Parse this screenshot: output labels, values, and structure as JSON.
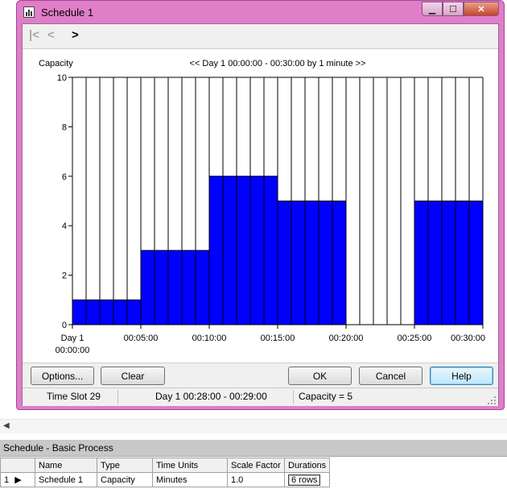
{
  "window": {
    "title": "Schedule 1"
  },
  "titlebar": {
    "minimize": "▁",
    "maximize": "☐",
    "close": "✕"
  },
  "nav": {
    "first": "|<",
    "prev": "<",
    "next": ">"
  },
  "chart_data": {
    "type": "bar",
    "ylabel": "Capacity",
    "title": "<< Day 1  00:00:00 - 00:30:00  by 1 minute >>",
    "ylim": [
      0,
      10
    ],
    "yticks": [
      0,
      2,
      4,
      6,
      8,
      10
    ],
    "xlim": [
      0,
      30
    ],
    "xticks": [
      {
        "pos": 0,
        "label": "Day 1\n00:00:00"
      },
      {
        "pos": 5,
        "label": "00:05:00"
      },
      {
        "pos": 10,
        "label": "00:10:00"
      },
      {
        "pos": 15,
        "label": "00:15:00"
      },
      {
        "pos": 20,
        "label": "00:20:00"
      },
      {
        "pos": 25,
        "label": "00:25:00"
      },
      {
        "pos": 30,
        "label": "00:30:00"
      }
    ],
    "values": [
      1,
      1,
      1,
      1,
      1,
      3,
      3,
      3,
      3,
      3,
      6,
      6,
      6,
      6,
      6,
      5,
      5,
      5,
      5,
      5,
      0,
      0,
      0,
      0,
      0,
      5,
      5,
      5,
      5,
      5
    ],
    "bar_color": "#0000ff",
    "grid": false
  },
  "buttons": {
    "options": "Options...",
    "clear": "Clear",
    "ok": "OK",
    "cancel": "Cancel",
    "help": "Help"
  },
  "status": {
    "slot": "Time Slot 29",
    "range": "Day 1  00:28:00 - 00:29:00",
    "capacity": "Capacity = 5"
  },
  "dock": {
    "title": "Schedule - Basic Process",
    "columns": [
      "Name",
      "Type",
      "Time Units",
      "Scale Factor",
      "Durations"
    ],
    "rows": [
      {
        "num": "1",
        "marker": "▶",
        "name": "Schedule 1",
        "type": "Capacity",
        "time_units": "Minutes",
        "scale": "1.0",
        "durations": "6 rows"
      }
    ]
  }
}
